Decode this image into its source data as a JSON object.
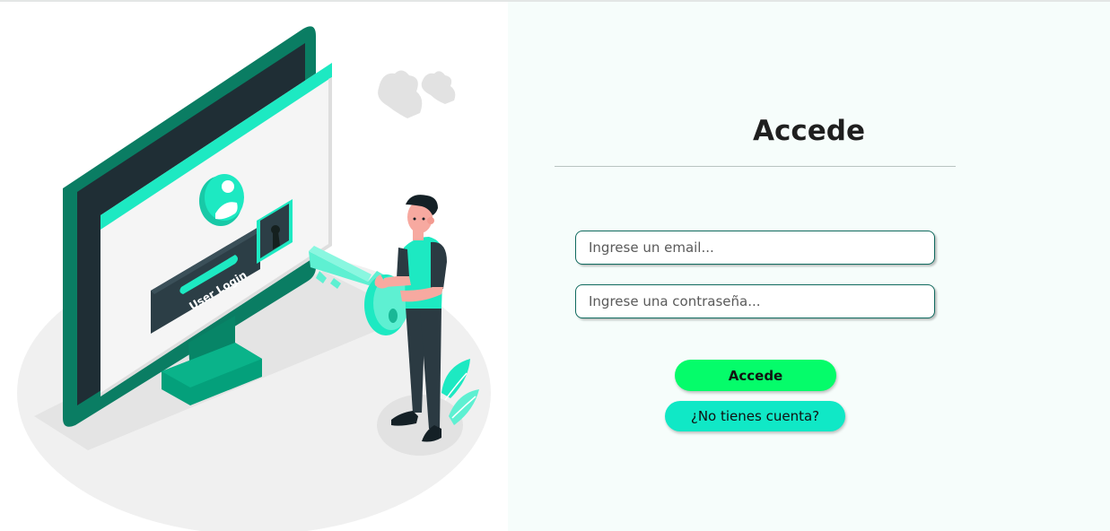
{
  "illustration": {
    "screen_label": "User Login"
  },
  "login_form": {
    "title": "Accede",
    "email_placeholder": "Ingrese un email...",
    "password_placeholder": "Ingrese una contraseña...",
    "submit_label": "Accede",
    "register_label": "¿No tienes cuenta?"
  },
  "colors": {
    "primary_teal": "#0a9a7a",
    "accent_mint": "#1de9c2",
    "login_button": "#05fc6a",
    "register_button": "#10e8c6",
    "panel_background": "#f6fdfb"
  }
}
